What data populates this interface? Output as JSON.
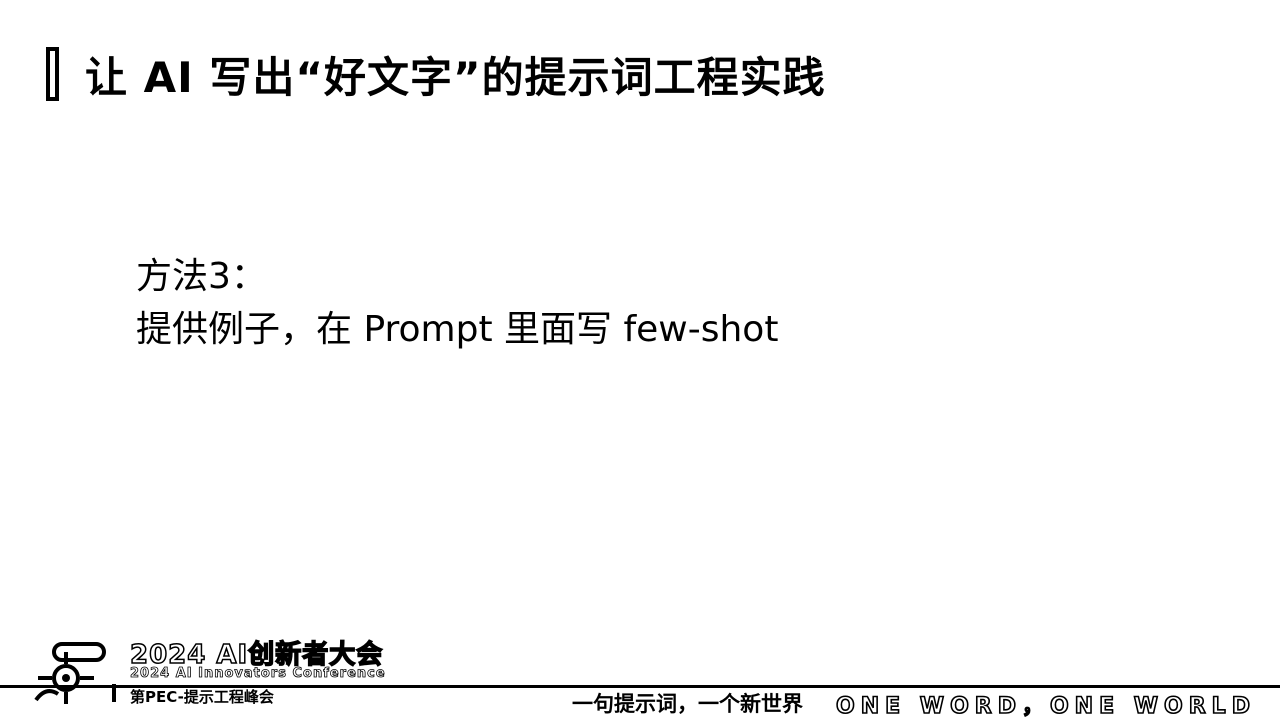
{
  "slide": {
    "title": "让 AI 写出“好文字”的提示词工程实践",
    "body": {
      "method_label": "方法3：",
      "method_text": "提供例子，在 Prompt 里面写 few-shot"
    }
  },
  "footer": {
    "conference_title": "2024 AI创新者大会",
    "conference_subtitle": "2024 AI Innovators Conference",
    "session": "第PEC-提示工程峰会",
    "slogan_cn": "一句提示词，一个新世界",
    "slogan_en": "ONE WORD，ONE WORLD"
  },
  "colors": {
    "background": "#ffffff",
    "text": "#000000"
  },
  "icons": {
    "title_marker": "bracket-icon",
    "logo": "conference-logo-icon"
  }
}
